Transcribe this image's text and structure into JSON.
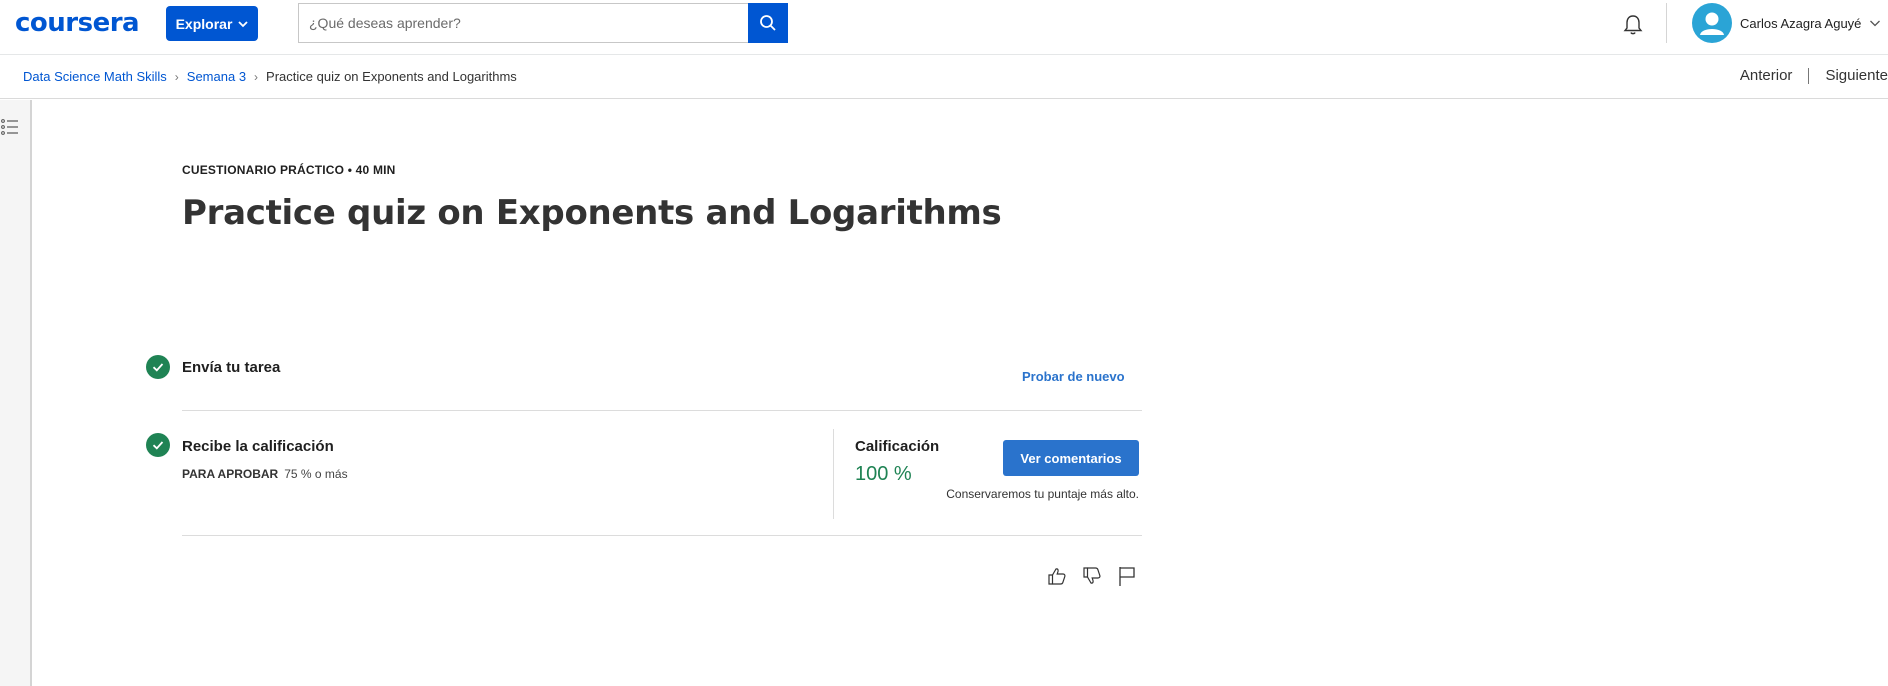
{
  "header": {
    "logo": "coursera",
    "explore_label": "Explorar",
    "search_placeholder": "¿Qué deseas aprender?",
    "user_name": "Carlos Azagra Aguyé"
  },
  "breadcrumb": {
    "items": [
      "Data Science Math Skills",
      "Semana 3"
    ],
    "current": "Practice quiz on Exponents and Logarithms"
  },
  "nav": {
    "prev": "Anterior",
    "next": "Siguiente"
  },
  "quiz": {
    "kicker": "CUESTIONARIO PRÁCTICO • 40 MIN",
    "title": "Practice quiz on Exponents and Logarithms"
  },
  "steps": {
    "submit_label": "Envía tu tarea",
    "retry_label": "Probar de nuevo",
    "receive_label": "Recibe la calificación",
    "pass_label": "PARA APROBAR",
    "pass_value": "75 % o más"
  },
  "grade": {
    "label": "Calificación",
    "value": "100 %",
    "feedback_button": "Ver comentarios",
    "note": "Conservaremos tu puntaje más alto."
  },
  "colors": {
    "brand": "#0056d2",
    "success": "#1f8354",
    "link": "#2a73cc"
  },
  "icons": [
    "search-icon",
    "bell-icon",
    "avatar-icon",
    "chevron-down-icon",
    "menu-list-icon",
    "check-icon",
    "thumbs-up-icon",
    "thumbs-down-icon",
    "flag-icon"
  ]
}
